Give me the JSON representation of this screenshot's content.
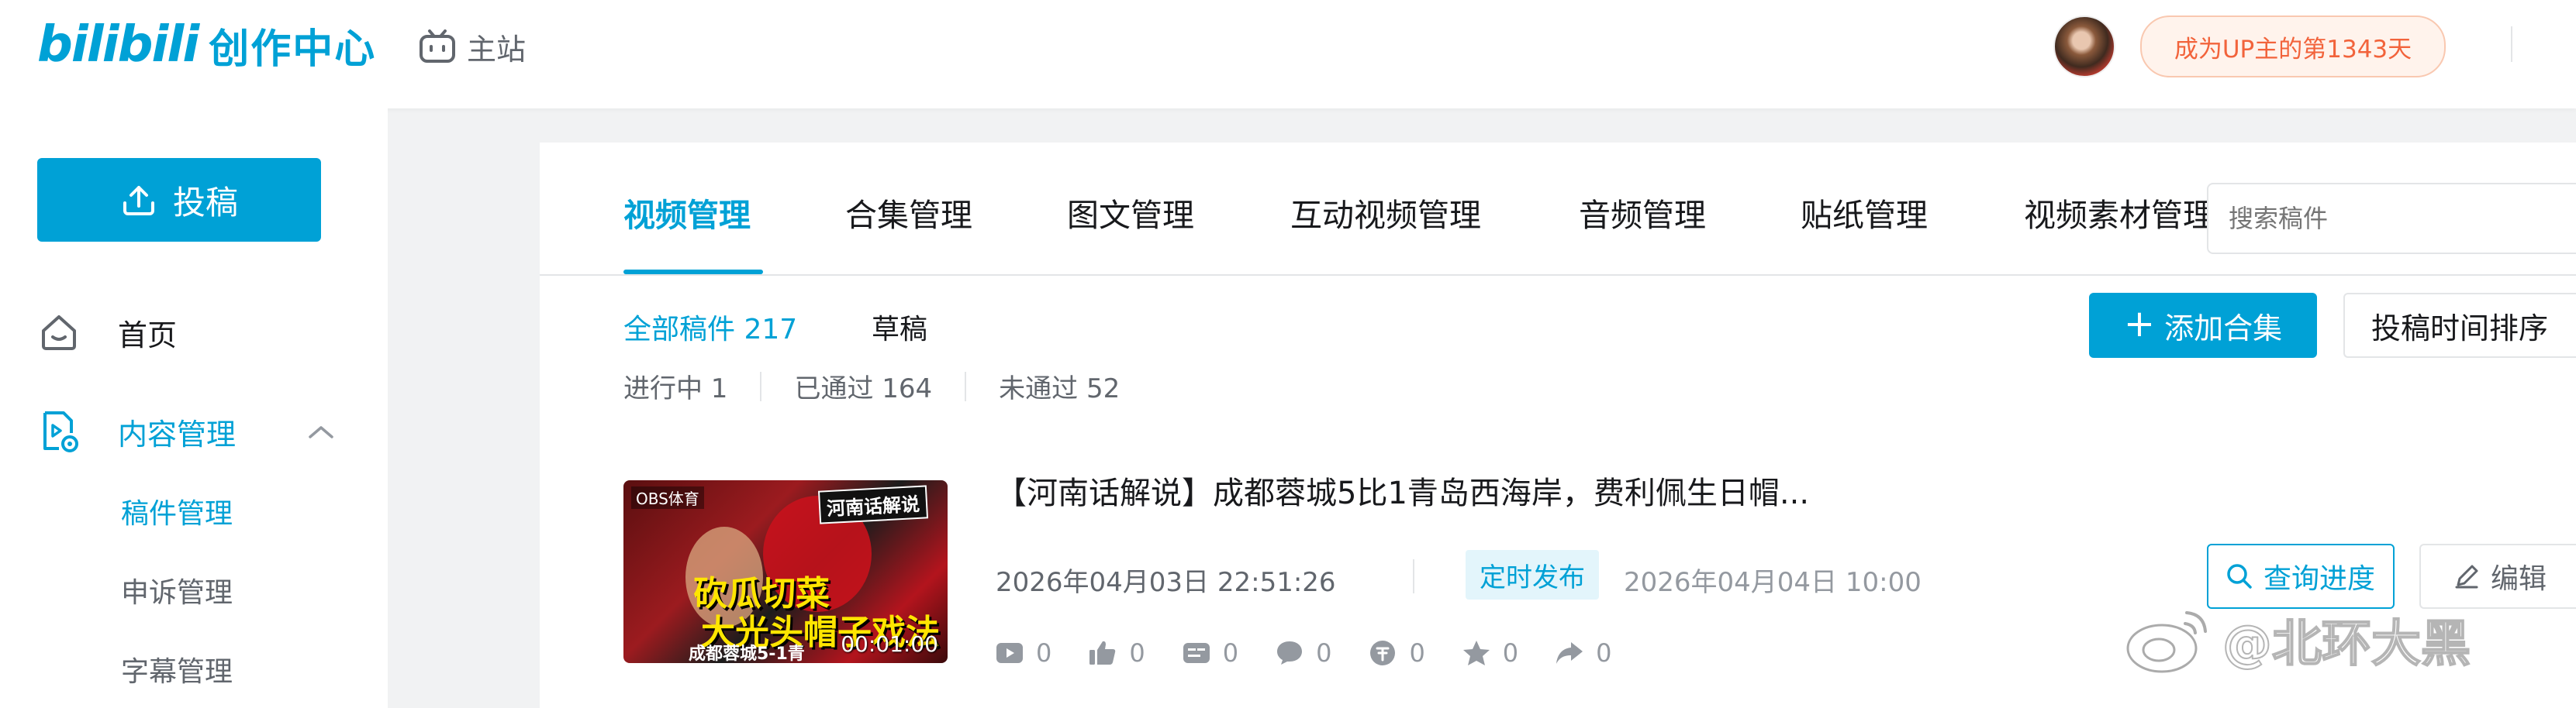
{
  "header": {
    "logo_text": "bilibili",
    "logo_subtitle": "创作中心",
    "main_site_label": "主站",
    "up_badge": "成为UP主的第1343天"
  },
  "sidebar": {
    "upload_label": "投稿",
    "items": [
      {
        "label": "首页",
        "icon": "home-icon"
      },
      {
        "label": "内容管理",
        "icon": "content-management-icon"
      }
    ],
    "sub_items": [
      {
        "label": "稿件管理"
      },
      {
        "label": "申诉管理"
      },
      {
        "label": "字幕管理"
      }
    ]
  },
  "tabs": [
    {
      "label": "视频管理"
    },
    {
      "label": "合集管理"
    },
    {
      "label": "图文管理"
    },
    {
      "label": "互动视频管理"
    },
    {
      "label": "音频管理"
    },
    {
      "label": "贴纸管理"
    },
    {
      "label": "视频素材管理"
    }
  ],
  "search": {
    "placeholder": "搜索稿件"
  },
  "filters": {
    "all": "全部稿件 217",
    "draft": "草稿",
    "in_progress": "进行中 1",
    "passed": "已通过 164",
    "rejected": "未通过 52"
  },
  "actions": {
    "add_collection": "添加合集",
    "sort": "投稿时间排序"
  },
  "video": {
    "title": "【河南话解说】成都蓉城5比1青岛西海岸，费利佩生日帽...",
    "thumb_tag": "河南话解说",
    "thumb_line1": "砍瓜切菜",
    "thumb_line2": "大光头帽子戏法",
    "thumb_bottom": "成都蓉城5-1青",
    "thumb_logo": "OBS体育",
    "duration": "00:01:00",
    "publish_time": "2026年04月03日 22:51:26",
    "schedule_badge": "定时发布",
    "schedule_time": "2026年04月04日 10:00",
    "stats": {
      "plays": "0",
      "likes": "0",
      "danmaku": "0",
      "comments": "0",
      "coins": "0",
      "favorites": "0",
      "shares": "0"
    },
    "progress_button": "查询进度",
    "edit_button": "编辑"
  },
  "watermark": "@北环大黑",
  "colors": {
    "accent": "#00a1d6",
    "badge_text": "#f2633b",
    "badge_bg": "#fff3ec"
  }
}
